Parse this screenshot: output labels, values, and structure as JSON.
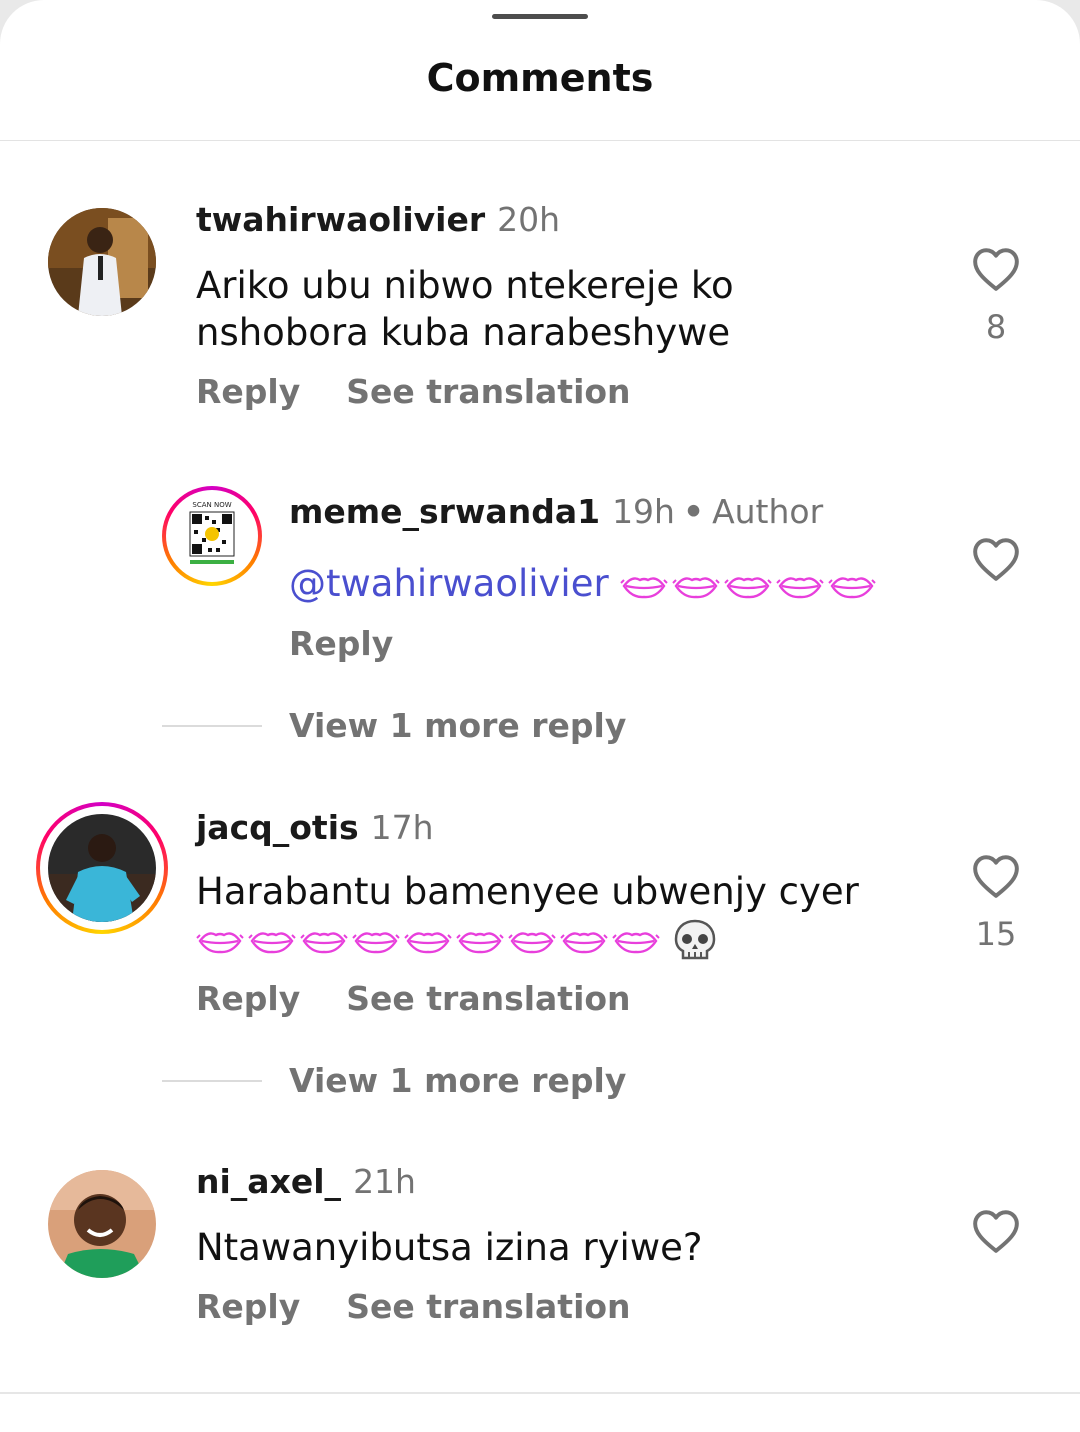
{
  "sheet": {
    "title": "Comments"
  },
  "comments": [
    {
      "username": "twahirwaolivier",
      "time": "20h",
      "text_line1": "Ariko ubu nibwo ntekereje ko",
      "text_line2": "nshobora kuba narabeshywe",
      "likes": "8",
      "reply": "Reply",
      "translate": "See translation"
    },
    {
      "username": "meme_srwanda1",
      "time": "19h",
      "badge": "Author",
      "mention": "@twahirwaolivier",
      "reply": "Reply",
      "view_more": "View 1 more reply",
      "qr_text_top": "SCAN NOW"
    },
    {
      "username": "jacq_otis",
      "time": "17h",
      "text_line1": "Harabantu bamenyee ubwenjy cyer",
      "likes": "15",
      "reply": "Reply",
      "translate": "See translation",
      "view_more": "View 1 more reply"
    },
    {
      "username": "ni_axel_",
      "time": "21h",
      "text_line1": "Ntawanyibutsa izina ryiwe?",
      "reply": "Reply",
      "translate": "See translation"
    }
  ],
  "colors": {
    "mention": "#4a4fcf",
    "emoji_lips": "#e83fdc",
    "muted": "#737373"
  },
  "icons": [
    "heart-outline-icon",
    "skull-emoji",
    "kiss-lips-emoji"
  ]
}
